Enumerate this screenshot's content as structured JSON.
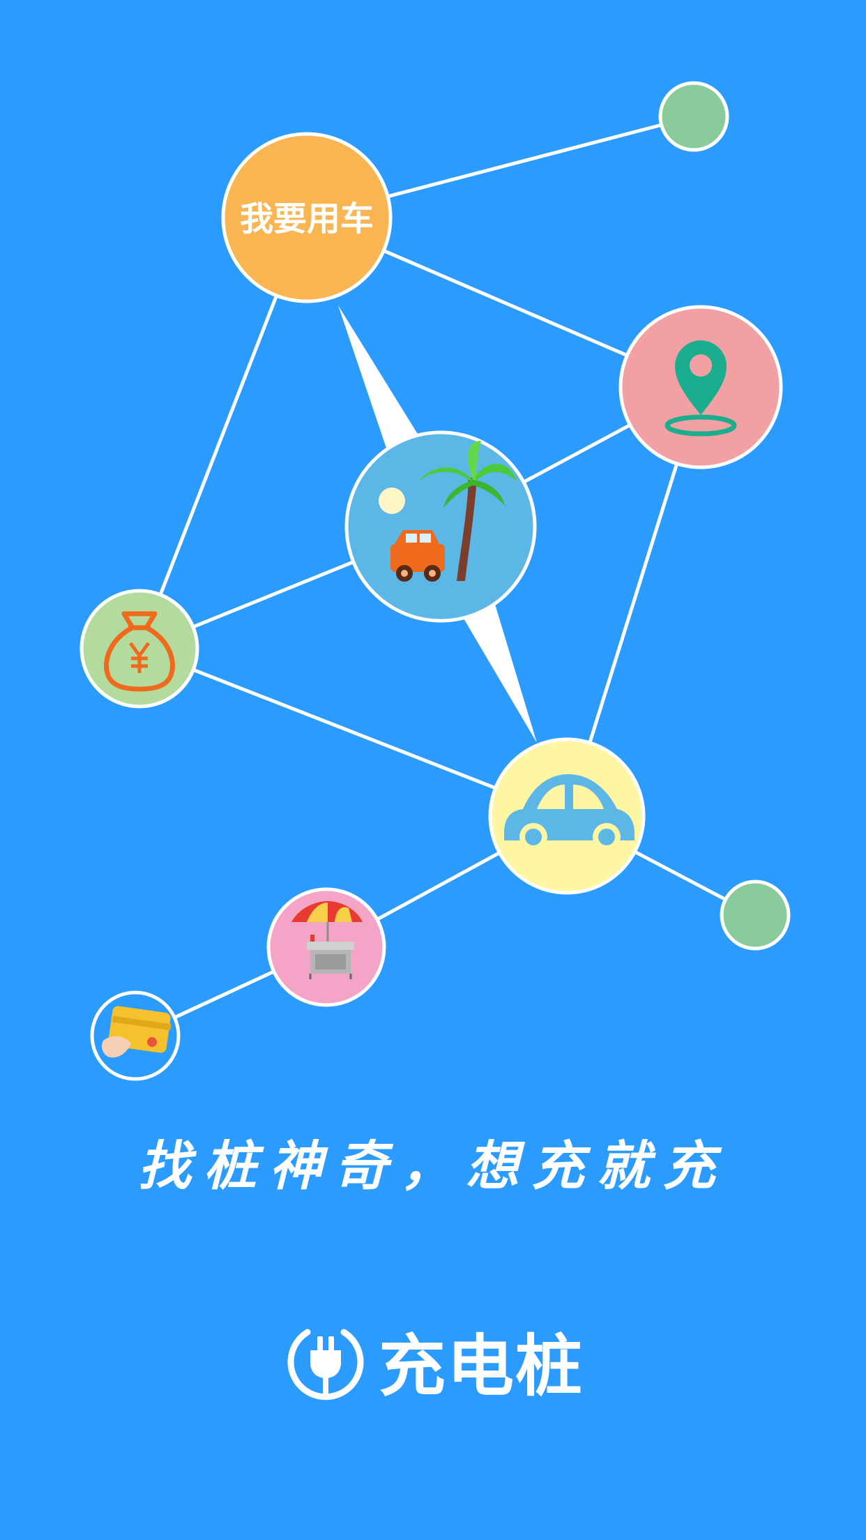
{
  "nodes": {
    "use_car_label": "我要用车"
  },
  "slogan": "找桩神奇，想充就充",
  "brand": {
    "name": "充电桩",
    "logo_icon": "plug-icon"
  },
  "icons": [
    "location-pin-icon",
    "beach-car-icon",
    "money-bag-icon",
    "car-icon",
    "vendor-cart-icon",
    "bank-card-icon"
  ],
  "colors": {
    "background": "#2B9BFD",
    "node_orange": "#F8B552",
    "node_pink": "#F2A0A3",
    "node_lightblue": "#5CB6E6",
    "node_green": "#B2DB9D",
    "node_yellow": "#FFF6A3",
    "node_rose": "#F4A4C7",
    "node_small_green": "#8ACB9C"
  }
}
